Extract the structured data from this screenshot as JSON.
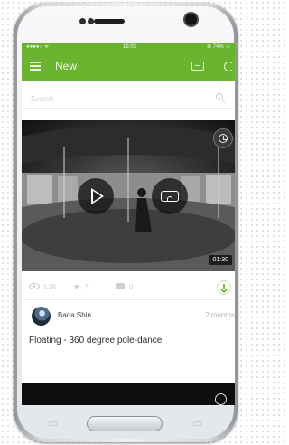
{
  "status_bar": {
    "left": "●●●●○ ᯤ",
    "time": "16:03",
    "right": "⊕ 74% ▭"
  },
  "app_bar": {
    "title": "New",
    "menu_icon": "hamburger-menu-icon",
    "vr_icon": "vr-headset-icon",
    "refresh_icon": "refresh-icon"
  },
  "search": {
    "placeholder": "Search",
    "icon": "search-icon"
  },
  "video_card": {
    "duration": "01:30",
    "views": "1.2K",
    "likes": "7",
    "comments": "0",
    "author": "Bada Shin",
    "posted": "2 months",
    "title": "Floating - 360 degree pole-dance"
  },
  "colors": {
    "accent": "#6ab42f",
    "status_bar": "#69b22e",
    "download": "#7bbd43"
  }
}
